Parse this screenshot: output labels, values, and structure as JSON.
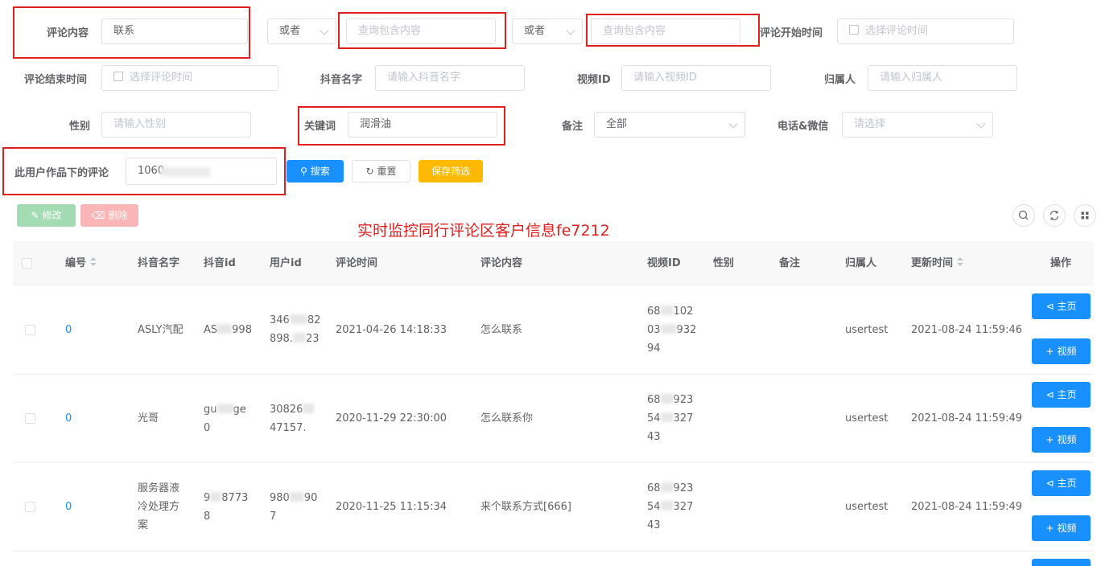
{
  "filters": {
    "comment_content": {
      "label": "评论内容",
      "value": "联系"
    },
    "or1": {
      "value": "或者"
    },
    "query1": {
      "placeholder": "查询包含内容"
    },
    "or2": {
      "value": "或者"
    },
    "query2": {
      "placeholder": "查询包含内容"
    },
    "start_time": {
      "label": "评论开始时间",
      "placeholder": "选择评论时间"
    },
    "end_time": {
      "label": "评论结束时间",
      "placeholder": "选择评论时间"
    },
    "douyin_name": {
      "label": "抖音名字",
      "placeholder": "请输入抖音名字"
    },
    "video_id": {
      "label": "视频ID",
      "placeholder": "请输入视频ID"
    },
    "owner": {
      "label": "归属人",
      "placeholder": "请输入归属人"
    },
    "gender": {
      "label": "性别",
      "placeholder": "请输入性别"
    },
    "keyword": {
      "label": "关键词",
      "value": "润滑油"
    },
    "remark": {
      "label": "备注",
      "value": "全部"
    },
    "phone_wechat": {
      "label": "电话&微信",
      "placeholder": "请选择"
    },
    "user_works_comment": {
      "label": "此用户作品下的评论",
      "value": "1060"
    }
  },
  "actions": {
    "search": "搜索",
    "reset": "重置",
    "save_filter": "保存筛选",
    "edit": "修改",
    "delete": "删除"
  },
  "watermark": "实时监控同行评论区客户信息fe7212",
  "table": {
    "headers": {
      "id": "编号",
      "name": "抖音名字",
      "douyin_id": "抖音id",
      "user_id": "用户id",
      "comment_time": "评论时间",
      "comment": "评论内容",
      "video_id": "视频ID",
      "gender": "性别",
      "remark": "备注",
      "owner": "归属人",
      "updated": "更新时间",
      "ops": "操作"
    },
    "rows": [
      {
        "id": "0",
        "name": [
          "ASLY汽配"
        ],
        "douyin_id": [
          "AS",
          "998"
        ],
        "user_id": [
          "346",
          "82",
          "898.",
          "23"
        ],
        "comment_time": "2021-04-26 14:18:33",
        "comment": "怎么联系",
        "video_id": [
          "68",
          "102",
          "03",
          "932",
          "94"
        ],
        "owner": "usertest",
        "updated": "2021-08-24 11:59:46"
      },
      {
        "id": "0",
        "name": [
          "光哥"
        ],
        "douyin_id": [
          "gu",
          "ge",
          "0"
        ],
        "user_id": [
          "30826",
          "47157."
        ],
        "comment_time": "2020-11-29 22:30:00",
        "comment": "怎么联系你",
        "video_id": [
          "68",
          "923",
          "54",
          "327",
          "43"
        ],
        "owner": "usertest",
        "updated": "2021-08-24 11:59:49"
      },
      {
        "id": "0",
        "name": [
          "服务器液",
          "冷处理方",
          "案"
        ],
        "douyin_id": [
          "9",
          "8773",
          "8"
        ],
        "user_id": [
          "980",
          "90",
          "7"
        ],
        "comment_time": "2020-11-25 11:15:34",
        "comment": "来个联系方式[666]",
        "video_id": [
          "68",
          "923",
          "54",
          "327",
          "43"
        ],
        "owner": "usertest",
        "updated": "2021-08-24 11:59:49"
      }
    ],
    "row_buttons": {
      "home": "主页",
      "video": "视频"
    }
  },
  "colors": {
    "primary": "#1890ff",
    "warning": "#ffba00",
    "annotation": "#e0201e",
    "link": "#1890ff"
  }
}
